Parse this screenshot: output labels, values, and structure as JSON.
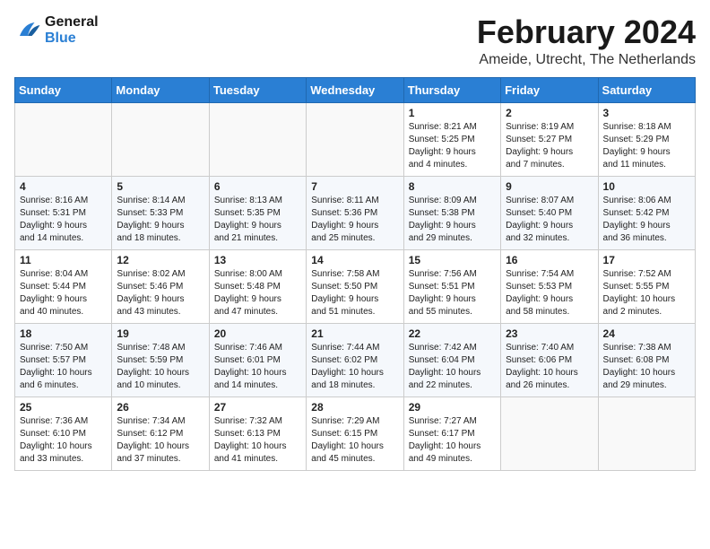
{
  "logo": {
    "line1": "General",
    "line2": "Blue"
  },
  "title": "February 2024",
  "subtitle": "Ameide, Utrecht, The Netherlands",
  "weekdays": [
    "Sunday",
    "Monday",
    "Tuesday",
    "Wednesday",
    "Thursday",
    "Friday",
    "Saturday"
  ],
  "weeks": [
    [
      {
        "day": "",
        "info": ""
      },
      {
        "day": "",
        "info": ""
      },
      {
        "day": "",
        "info": ""
      },
      {
        "day": "",
        "info": ""
      },
      {
        "day": "1",
        "info": "Sunrise: 8:21 AM\nSunset: 5:25 PM\nDaylight: 9 hours\nand 4 minutes."
      },
      {
        "day": "2",
        "info": "Sunrise: 8:19 AM\nSunset: 5:27 PM\nDaylight: 9 hours\nand 7 minutes."
      },
      {
        "day": "3",
        "info": "Sunrise: 8:18 AM\nSunset: 5:29 PM\nDaylight: 9 hours\nand 11 minutes."
      }
    ],
    [
      {
        "day": "4",
        "info": "Sunrise: 8:16 AM\nSunset: 5:31 PM\nDaylight: 9 hours\nand 14 minutes."
      },
      {
        "day": "5",
        "info": "Sunrise: 8:14 AM\nSunset: 5:33 PM\nDaylight: 9 hours\nand 18 minutes."
      },
      {
        "day": "6",
        "info": "Sunrise: 8:13 AM\nSunset: 5:35 PM\nDaylight: 9 hours\nand 21 minutes."
      },
      {
        "day": "7",
        "info": "Sunrise: 8:11 AM\nSunset: 5:36 PM\nDaylight: 9 hours\nand 25 minutes."
      },
      {
        "day": "8",
        "info": "Sunrise: 8:09 AM\nSunset: 5:38 PM\nDaylight: 9 hours\nand 29 minutes."
      },
      {
        "day": "9",
        "info": "Sunrise: 8:07 AM\nSunset: 5:40 PM\nDaylight: 9 hours\nand 32 minutes."
      },
      {
        "day": "10",
        "info": "Sunrise: 8:06 AM\nSunset: 5:42 PM\nDaylight: 9 hours\nand 36 minutes."
      }
    ],
    [
      {
        "day": "11",
        "info": "Sunrise: 8:04 AM\nSunset: 5:44 PM\nDaylight: 9 hours\nand 40 minutes."
      },
      {
        "day": "12",
        "info": "Sunrise: 8:02 AM\nSunset: 5:46 PM\nDaylight: 9 hours\nand 43 minutes."
      },
      {
        "day": "13",
        "info": "Sunrise: 8:00 AM\nSunset: 5:48 PM\nDaylight: 9 hours\nand 47 minutes."
      },
      {
        "day": "14",
        "info": "Sunrise: 7:58 AM\nSunset: 5:50 PM\nDaylight: 9 hours\nand 51 minutes."
      },
      {
        "day": "15",
        "info": "Sunrise: 7:56 AM\nSunset: 5:51 PM\nDaylight: 9 hours\nand 55 minutes."
      },
      {
        "day": "16",
        "info": "Sunrise: 7:54 AM\nSunset: 5:53 PM\nDaylight: 9 hours\nand 58 minutes."
      },
      {
        "day": "17",
        "info": "Sunrise: 7:52 AM\nSunset: 5:55 PM\nDaylight: 10 hours\nand 2 minutes."
      }
    ],
    [
      {
        "day": "18",
        "info": "Sunrise: 7:50 AM\nSunset: 5:57 PM\nDaylight: 10 hours\nand 6 minutes."
      },
      {
        "day": "19",
        "info": "Sunrise: 7:48 AM\nSunset: 5:59 PM\nDaylight: 10 hours\nand 10 minutes."
      },
      {
        "day": "20",
        "info": "Sunrise: 7:46 AM\nSunset: 6:01 PM\nDaylight: 10 hours\nand 14 minutes."
      },
      {
        "day": "21",
        "info": "Sunrise: 7:44 AM\nSunset: 6:02 PM\nDaylight: 10 hours\nand 18 minutes."
      },
      {
        "day": "22",
        "info": "Sunrise: 7:42 AM\nSunset: 6:04 PM\nDaylight: 10 hours\nand 22 minutes."
      },
      {
        "day": "23",
        "info": "Sunrise: 7:40 AM\nSunset: 6:06 PM\nDaylight: 10 hours\nand 26 minutes."
      },
      {
        "day": "24",
        "info": "Sunrise: 7:38 AM\nSunset: 6:08 PM\nDaylight: 10 hours\nand 29 minutes."
      }
    ],
    [
      {
        "day": "25",
        "info": "Sunrise: 7:36 AM\nSunset: 6:10 PM\nDaylight: 10 hours\nand 33 minutes."
      },
      {
        "day": "26",
        "info": "Sunrise: 7:34 AM\nSunset: 6:12 PM\nDaylight: 10 hours\nand 37 minutes."
      },
      {
        "day": "27",
        "info": "Sunrise: 7:32 AM\nSunset: 6:13 PM\nDaylight: 10 hours\nand 41 minutes."
      },
      {
        "day": "28",
        "info": "Sunrise: 7:29 AM\nSunset: 6:15 PM\nDaylight: 10 hours\nand 45 minutes."
      },
      {
        "day": "29",
        "info": "Sunrise: 7:27 AM\nSunset: 6:17 PM\nDaylight: 10 hours\nand 49 minutes."
      },
      {
        "day": "",
        "info": ""
      },
      {
        "day": "",
        "info": ""
      }
    ]
  ]
}
